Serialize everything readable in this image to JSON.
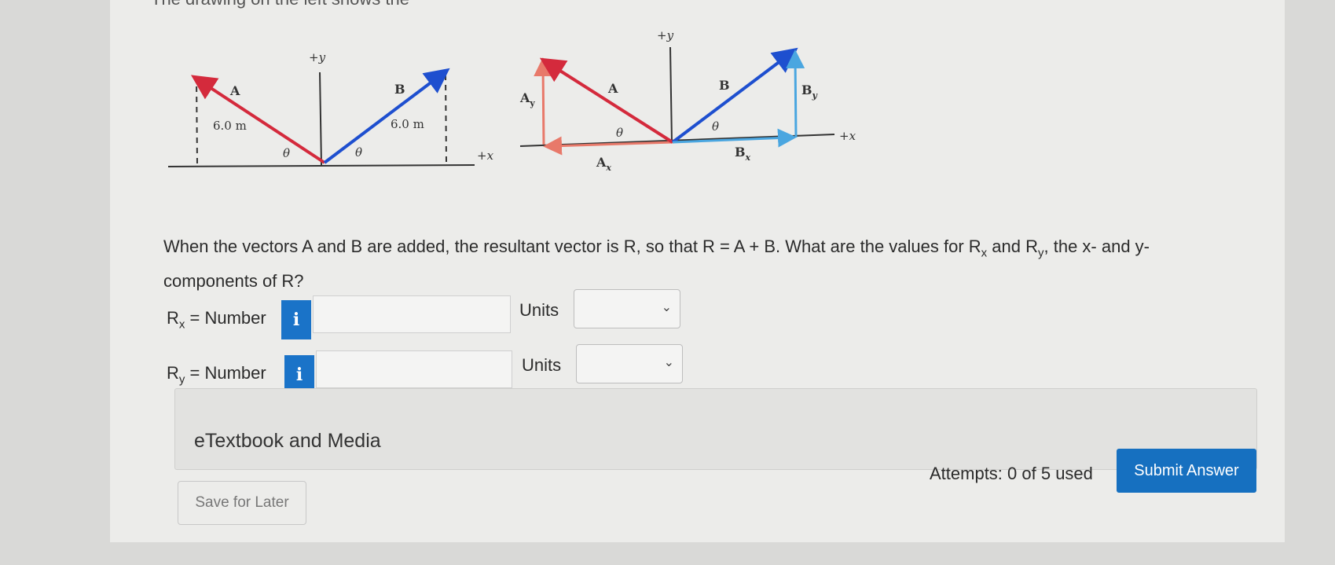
{
  "top_partial_text": "The drawing on the left shows the",
  "diagram_left": {
    "vector_a_label": "A",
    "vector_b_label": "B",
    "length_a": "6.0 m",
    "length_b": "6.0 m",
    "theta_left": "θ",
    "theta_right": "θ",
    "y_axis_label": "+y",
    "x_axis_label": "+x"
  },
  "diagram_right": {
    "vector_a_label": "A",
    "vector_b_label": "B",
    "ay_label": "A",
    "ay_sub": "y",
    "ax_label": "A",
    "ax_sub": "x",
    "bx_label": "B",
    "bx_sub": "x",
    "by_label": "B",
    "by_sub": "y",
    "theta_left": "θ",
    "theta_right": "θ",
    "y_axis_label": "+y",
    "x_axis_label": "+x"
  },
  "question": {
    "part1": "When the vectors A and B are added, the resultant vector is R, so that R = A + B. What are the values for R",
    "sub_x": "x",
    "part2": " and R",
    "sub_y": "y",
    "part3": ", the x- and y-components of R?"
  },
  "rx_row": {
    "label_main": "R",
    "label_sub": "x",
    "label_rest": " = Number",
    "info": "i",
    "value": "",
    "units_label": "Units",
    "units_value": ""
  },
  "ry_row": {
    "label_main": "R",
    "label_sub": "y",
    "label_rest": " = Number",
    "info": "i",
    "value": "",
    "units_label": "Units",
    "units_value": ""
  },
  "etextbook_label": "eTextbook and Media",
  "save_button": "Save for Later",
  "attempts": "Attempts: 0 of 5 used",
  "submit_button": "Submit Answer",
  "colors": {
    "vector_a": "#d42a3c",
    "vector_b": "#1e4fcf",
    "components": "#4aa6e0",
    "button_blue": "#1670c0"
  },
  "icons": {
    "info": "info-icon",
    "dropdown": "chevron-down-icon"
  }
}
